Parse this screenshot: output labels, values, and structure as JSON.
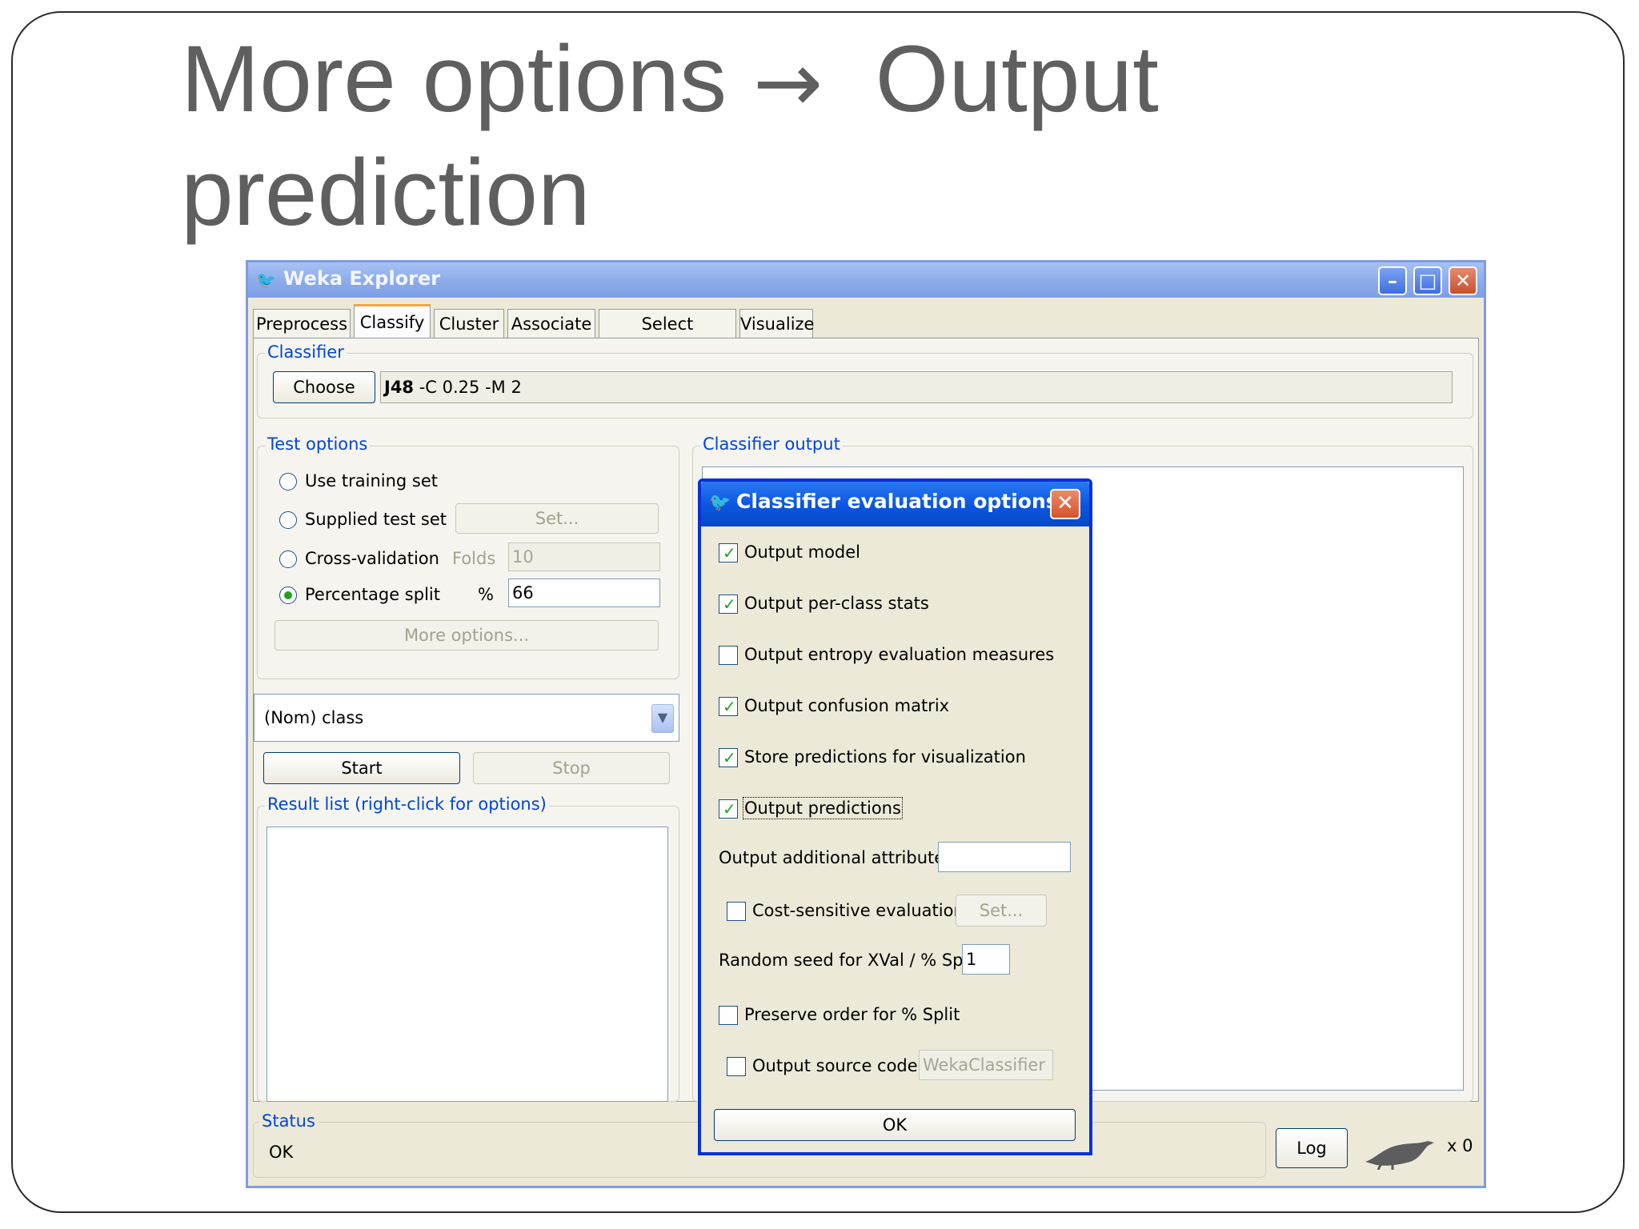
{
  "slide": {
    "title_line1_a": "More options",
    "title_arrow": "→",
    "title_line1_b": "Output",
    "title_line2": "prediction"
  },
  "window": {
    "title": "Weka Explorer",
    "controls": {
      "minimize": "–",
      "maximize": "□",
      "close": "✕"
    }
  },
  "tabs": [
    {
      "label": "Preprocess",
      "active": false
    },
    {
      "label": "Classify",
      "active": true
    },
    {
      "label": "Cluster",
      "active": false
    },
    {
      "label": "Associate",
      "active": false
    },
    {
      "label": "Select attributes",
      "active": false
    },
    {
      "label": "Visualize",
      "active": false
    }
  ],
  "classifier": {
    "group_label": "Classifier",
    "choose_label": "Choose",
    "name": "J48",
    "params": " -C 0.25 -M 2"
  },
  "test_options": {
    "group_label": "Test options",
    "use_training_set": "Use training set",
    "supplied_test_set": "Supplied test set",
    "set_label": "Set...",
    "cross_validation": "Cross-validation",
    "folds_label": "Folds",
    "folds_value": "10",
    "percentage_split": "Percentage split",
    "percent_label": "%",
    "percent_value": "66",
    "selected": "percentage_split",
    "more_options": "More options..."
  },
  "class_select": {
    "value": "(Nom) class"
  },
  "actions": {
    "start": "Start",
    "stop": "Stop"
  },
  "result_list": {
    "label": "Result list (right-click for options)"
  },
  "classifier_output": {
    "label": "Classifier output"
  },
  "status": {
    "label": "Status",
    "text": "OK",
    "log": "Log",
    "count": "x 0"
  },
  "dialog": {
    "title": "Classifier evaluation options",
    "close": "✕",
    "output_model": {
      "label": "Output model",
      "checked": true
    },
    "per_class_stats": {
      "label": "Output per-class stats",
      "checked": true
    },
    "entropy": {
      "label": "Output entropy evaluation measures",
      "checked": false
    },
    "confusion_matrix": {
      "label": "Output confusion matrix",
      "checked": true
    },
    "store_predictions": {
      "label": "Store predictions for visualization",
      "checked": true
    },
    "output_predictions": {
      "label": "Output predictions",
      "checked": true
    },
    "additional_attributes": {
      "label": "Output additional attributes",
      "value": ""
    },
    "cost_sensitive": {
      "label": "Cost-sensitive evaluation",
      "checked": false,
      "set_label": "Set..."
    },
    "random_seed": {
      "label": "Random seed for XVal / % Split",
      "value": "1"
    },
    "preserve_order": {
      "label": "Preserve order for % Split",
      "checked": false
    },
    "source_code": {
      "label": "Output source code",
      "checked": false,
      "value": "WekaClassifier"
    },
    "ok": "OK"
  },
  "colors": {
    "group_label": "#0046d5",
    "dialog_border": "#0831d9",
    "check_mark": "#21a121",
    "window_bg": "#ece9d8"
  }
}
